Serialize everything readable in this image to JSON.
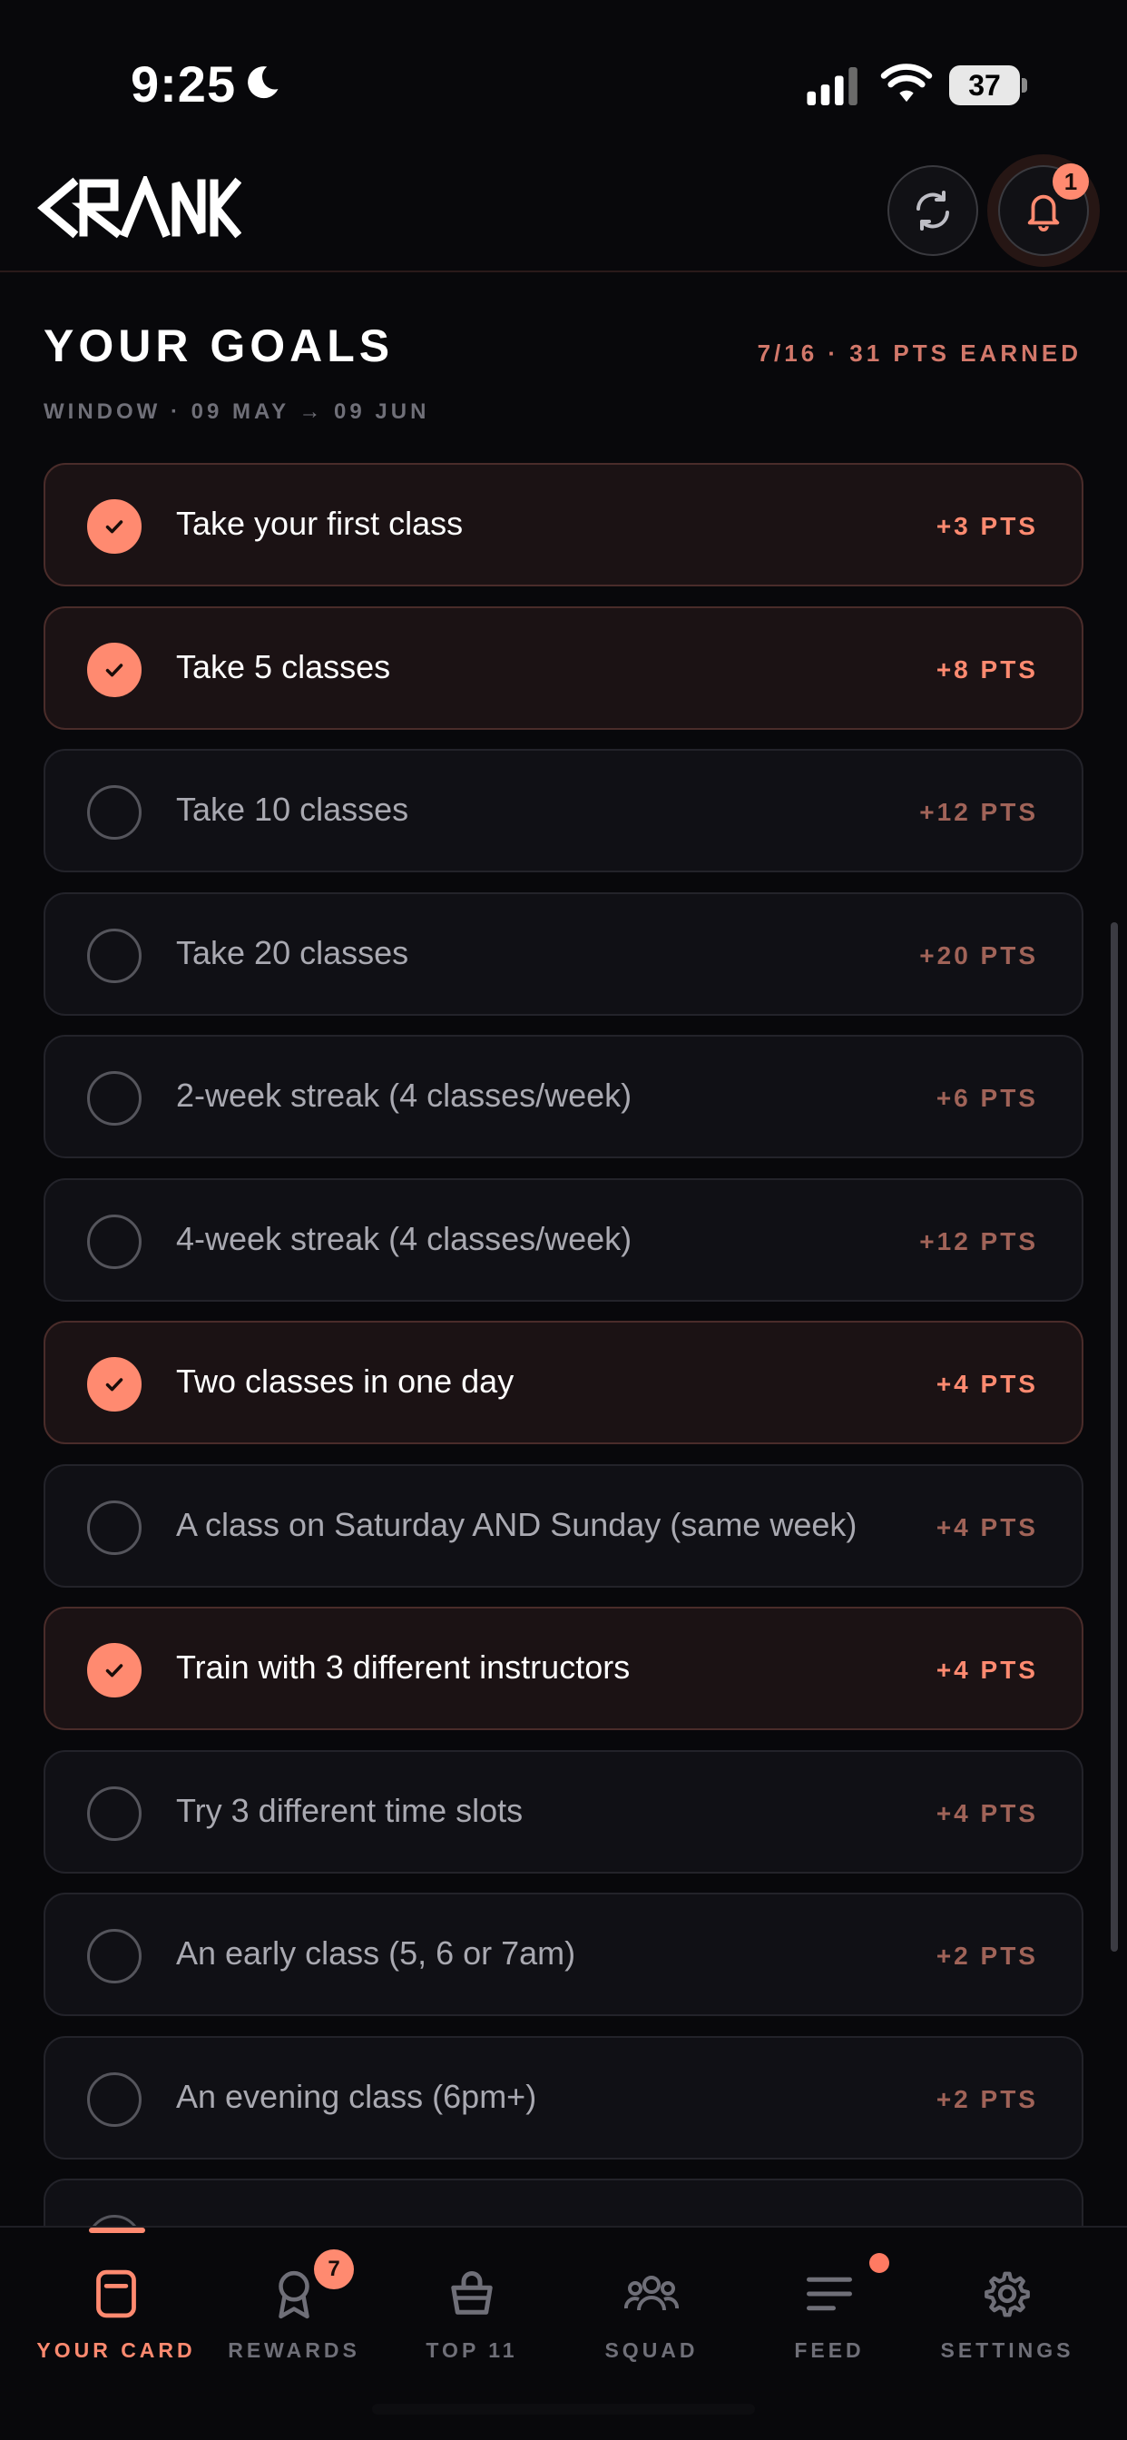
{
  "status_bar": {
    "time": "9:25",
    "battery": "37"
  },
  "header": {
    "logo_text": "CRANK",
    "notification_count": "1"
  },
  "goals": {
    "title": "YOUR GOALS",
    "summary": "7/16 · 31 PTS EARNED",
    "window": "WINDOW · 09 MAY → 09 JUN",
    "items": [
      {
        "label": "Take your first class",
        "points": "+3 PTS",
        "done": true
      },
      {
        "label": "Take 5 classes",
        "points": "+8 PTS",
        "done": true
      },
      {
        "label": "Take 10 classes",
        "points": "+12 PTS",
        "done": false
      },
      {
        "label": "Take 20 classes",
        "points": "+20 PTS",
        "done": false
      },
      {
        "label": "2-week streak (4 classes/week)",
        "points": "+6 PTS",
        "done": false
      },
      {
        "label": "4-week streak (4 classes/week)",
        "points": "+12 PTS",
        "done": false
      },
      {
        "label": "Two classes in one day",
        "points": "+4 PTS",
        "done": true
      },
      {
        "label": "A class on Saturday AND Sunday (same week)",
        "points": "+4 PTS",
        "done": false
      },
      {
        "label": "Train with 3 different instructors",
        "points": "+4 PTS",
        "done": true
      },
      {
        "label": "Try 3 different time slots",
        "points": "+4 PTS",
        "done": false
      },
      {
        "label": "An early class (5, 6 or 7am)",
        "points": "+2 PTS",
        "done": false
      },
      {
        "label": "An evening class (6pm+)",
        "points": "+2 PTS",
        "done": false
      }
    ]
  },
  "nav": {
    "items": [
      {
        "label": "YOUR CARD",
        "icon": "card-icon",
        "active": true
      },
      {
        "label": "REWARDS",
        "icon": "award-icon",
        "active": false
      },
      {
        "label": "TOP 11",
        "icon": "basket-icon",
        "active": false
      },
      {
        "label": "SQUAD",
        "icon": "group-icon",
        "active": false
      },
      {
        "label": "FEED",
        "icon": "feed-icon",
        "active": false
      },
      {
        "label": "SETTINGS",
        "icon": "gear-icon",
        "active": false
      }
    ],
    "rewards_badge": "7"
  },
  "colors": {
    "accent": "#ff8a70",
    "background": "#08080b",
    "card_done": "#1b1214",
    "card": "#101015"
  }
}
